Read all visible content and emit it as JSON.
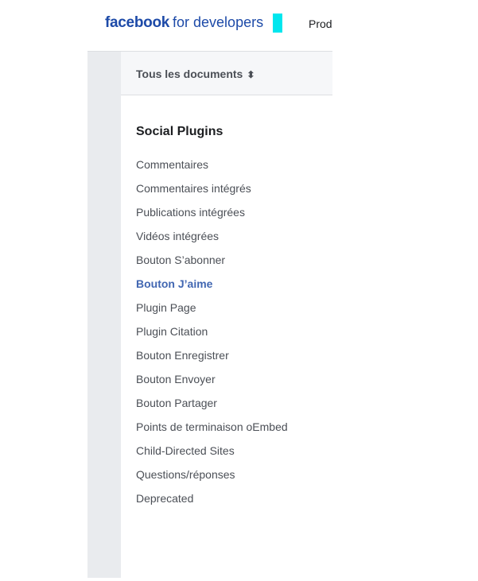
{
  "header": {
    "logo_brand": "facebook",
    "logo_suffix": "for developers",
    "nav_products": "Produits"
  },
  "sidebar": {
    "doc_selector_label": "Tous les documents",
    "section_title": "Social Plugins",
    "items": [
      {
        "label": "Commentaires",
        "active": false
      },
      {
        "label": "Commentaires intégrés",
        "active": false
      },
      {
        "label": "Publications intégrées",
        "active": false
      },
      {
        "label": "Vidéos intégrées",
        "active": false
      },
      {
        "label": "Bouton S’abonner",
        "active": false
      },
      {
        "label": "Bouton J’aime",
        "active": true
      },
      {
        "label": "Plugin Page",
        "active": false
      },
      {
        "label": "Plugin Citation",
        "active": false
      },
      {
        "label": "Bouton Enregistrer",
        "active": false
      },
      {
        "label": "Bouton Envoyer",
        "active": false
      },
      {
        "label": "Bouton Partager",
        "active": false
      },
      {
        "label": "Points de terminaison oEmbed",
        "active": false
      },
      {
        "label": "Child-Directed Sites",
        "active": false
      },
      {
        "label": "Questions/réponses",
        "active": false
      },
      {
        "label": "Deprecated",
        "active": false
      }
    ]
  },
  "colors": {
    "brand": "#1d4aa8",
    "active_link": "#4267b2",
    "gutter": "#e9ebee",
    "cursor": "#00e6ee"
  }
}
